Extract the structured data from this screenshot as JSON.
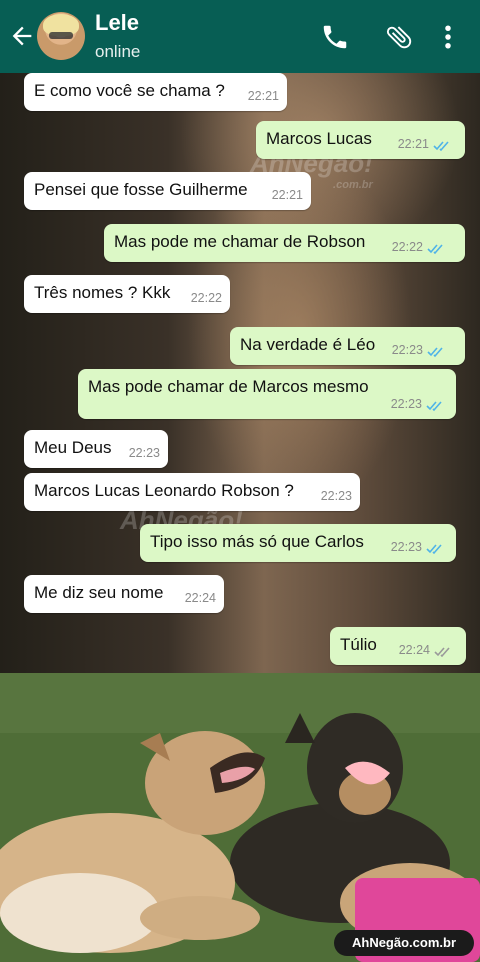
{
  "header": {
    "contact_name": "Lele",
    "status": "online",
    "color": "#075e54",
    "icons": [
      "back-arrow-icon",
      "phone-icon",
      "paperclip-icon",
      "more-vert-icon"
    ]
  },
  "watermark": {
    "text": "AhNegão!",
    "domain": ".com.br"
  },
  "messages": [
    {
      "dir": "in",
      "text": "E como você se chama ?",
      "time": "22:21"
    },
    {
      "dir": "out",
      "text": "Marcos Lucas",
      "time": "22:21"
    },
    {
      "dir": "in",
      "text": "Pensei que fosse Guilherme",
      "time": "22:21"
    },
    {
      "dir": "out",
      "text": "Mas pode me chamar de Robson",
      "time": "22:22"
    },
    {
      "dir": "in",
      "text": "Três nomes ? Kkk",
      "time": "22:22"
    },
    {
      "dir": "out",
      "text": "Na verdade é Léo",
      "time": "22:23"
    },
    {
      "dir": "out",
      "text": "Mas pode chamar de Marcos mesmo",
      "time": "22:23"
    },
    {
      "dir": "in",
      "text": "Meu Deus",
      "time": "22:23"
    },
    {
      "dir": "in",
      "text": "Marcos Lucas Leonardo Robson ?",
      "time": "22:23"
    },
    {
      "dir": "out",
      "text": "Tipo isso más só que Carlos",
      "time": "22:23"
    },
    {
      "dir": "in",
      "text": "Me diz seu nome",
      "time": "22:24"
    },
    {
      "dir": "out",
      "text": "Túlio",
      "time": "22:24"
    }
  ],
  "bubble_colors": {
    "incoming": "#ffffff",
    "outgoing": "#dcf8c6",
    "tick": "#4fb3e8"
  },
  "footer_logo": "AhNegão.com.br"
}
